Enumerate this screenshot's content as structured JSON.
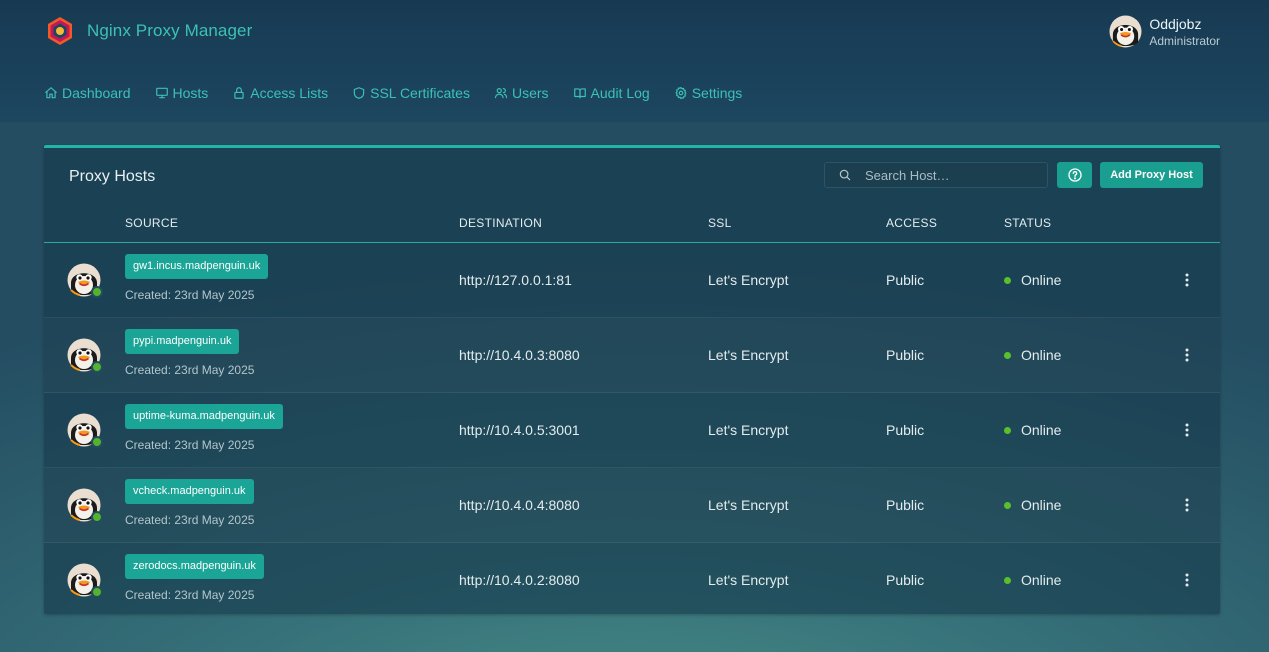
{
  "app": {
    "title": "Nginx Proxy Manager",
    "colors": {
      "accent": "#3cc1b4",
      "button": "#1a9e8f",
      "online": "#5bbf2a",
      "header_bg": "#173a52"
    }
  },
  "user": {
    "name": "Oddjobz",
    "role": "Administrator"
  },
  "nav": [
    {
      "label": "Dashboard",
      "icon": "home-icon"
    },
    {
      "label": "Hosts",
      "icon": "monitor-icon"
    },
    {
      "label": "Access Lists",
      "icon": "lock-icon"
    },
    {
      "label": "SSL Certificates",
      "icon": "shield-icon"
    },
    {
      "label": "Users",
      "icon": "users-icon"
    },
    {
      "label": "Audit Log",
      "icon": "book-icon"
    },
    {
      "label": "Settings",
      "icon": "gear-icon"
    }
  ],
  "card": {
    "title": "Proxy Hosts",
    "search_placeholder": "Search Host…",
    "add_label": "Add Proxy Host"
  },
  "table": {
    "columns": [
      "SOURCE",
      "DESTINATION",
      "SSL",
      "ACCESS",
      "STATUS"
    ],
    "rows": [
      {
        "source": "gw1.incus.madpenguin.uk",
        "created": "Created: 23rd May 2025",
        "destination": "http://127.0.0.1:81",
        "ssl": "Let's Encrypt",
        "access": "Public",
        "status": "Online"
      },
      {
        "source": "pypi.madpenguin.uk",
        "created": "Created: 23rd May 2025",
        "destination": "http://10.4.0.3:8080",
        "ssl": "Let's Encrypt",
        "access": "Public",
        "status": "Online"
      },
      {
        "source": "uptime-kuma.madpenguin.uk",
        "created": "Created: 23rd May 2025",
        "destination": "http://10.4.0.5:3001",
        "ssl": "Let's Encrypt",
        "access": "Public",
        "status": "Online"
      },
      {
        "source": "vcheck.madpenguin.uk",
        "created": "Created: 23rd May 2025",
        "destination": "http://10.4.0.4:8080",
        "ssl": "Let's Encrypt",
        "access": "Public",
        "status": "Online"
      },
      {
        "source": "zerodocs.madpenguin.uk",
        "created": "Created: 23rd May 2025",
        "destination": "http://10.4.0.2:8080",
        "ssl": "Let's Encrypt",
        "access": "Public",
        "status": "Online"
      }
    ]
  }
}
